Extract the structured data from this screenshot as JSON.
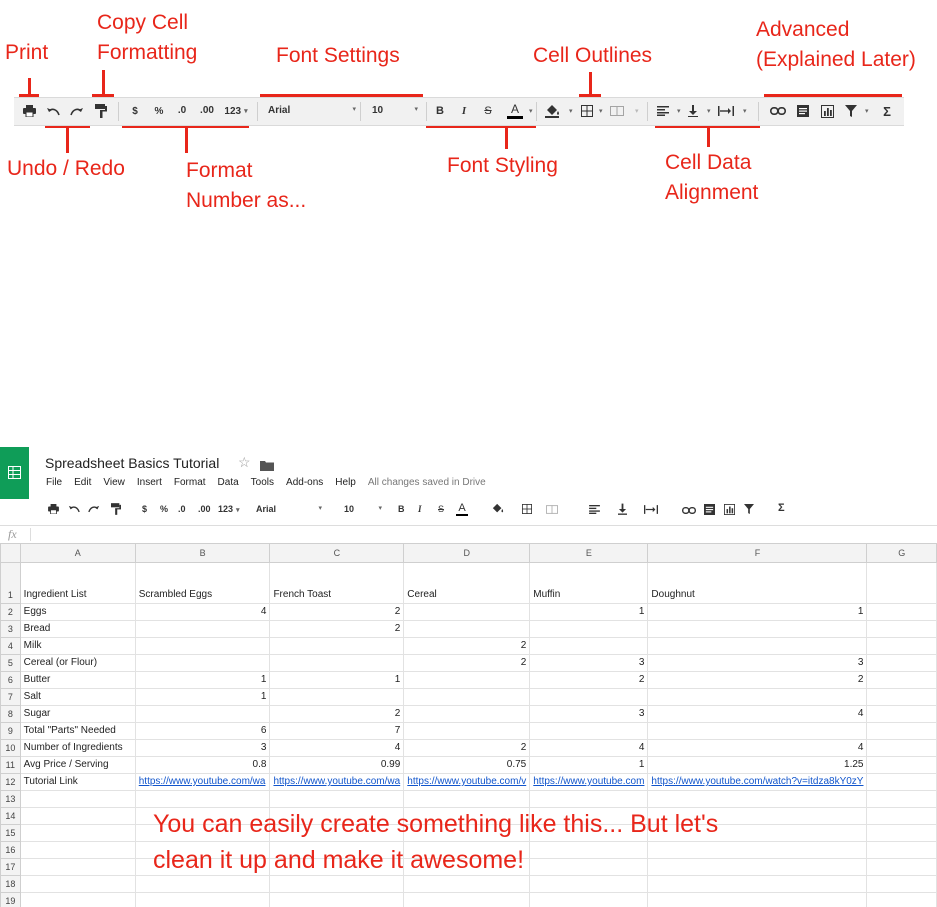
{
  "annotations": {
    "print": "Print",
    "copy_cell_1": "Copy Cell",
    "copy_cell_2": "Formatting",
    "font_settings": "Font Settings",
    "cell_outlines": "Cell Outlines",
    "advanced_1": "Advanced",
    "advanced_2": "(Explained Later)",
    "undo_redo": "Undo / Redo",
    "format_number_1": "Format",
    "format_number_2": "Number as...",
    "font_styling": "Font Styling",
    "cell_data_1": "Cell Data",
    "cell_data_2": "Alignment",
    "bottom_1": "You can easily create something like this... But let's",
    "bottom_2": "clean it up and make it awesome!"
  },
  "toolbar": {
    "dollar": "$",
    "percent": "%",
    "dec_less": ".0",
    "dec_more": ".00",
    "more_formats": "123",
    "font": "Arial",
    "size": "10",
    "bold": "B",
    "italic": "I",
    "strike": "S",
    "text_color": "A",
    "sigma": "Σ"
  },
  "app": {
    "title": "Spreadsheet Basics Tutorial",
    "menu": [
      "File",
      "Edit",
      "View",
      "Insert",
      "Format",
      "Data",
      "Tools",
      "Add-ons",
      "Help"
    ],
    "save_status": "All changes saved in Drive",
    "fx": "fx",
    "accent": "#0f9d58"
  },
  "sheet": {
    "columns": [
      "A",
      "B",
      "C",
      "D",
      "E",
      "F",
      "G"
    ],
    "rows": [
      [
        "Ingredient List",
        "Scrambled Eggs",
        "French Toast",
        "Cereal",
        "Muffin",
        "Doughnut",
        ""
      ],
      [
        "Eggs",
        "4",
        "2",
        "",
        "1",
        "1",
        ""
      ],
      [
        "Bread",
        "",
        "2",
        "",
        "",
        "",
        ""
      ],
      [
        "Milk",
        "",
        "",
        "2",
        "",
        "",
        ""
      ],
      [
        "Cereal (or Flour)",
        "",
        "",
        "2",
        "3",
        "3",
        ""
      ],
      [
        "Butter",
        "1",
        "1",
        "",
        "2",
        "2",
        ""
      ],
      [
        "Salt",
        "1",
        "",
        "",
        "",
        "",
        ""
      ],
      [
        "Sugar",
        "",
        "2",
        "",
        "3",
        "4",
        ""
      ],
      [
        "Total \"Parts\" Needed",
        "6",
        "7",
        "",
        "",
        "",
        ""
      ],
      [
        "Number of Ingredients",
        "3",
        "4",
        "2",
        "4",
        "4",
        ""
      ],
      [
        "Avg Price / Serving",
        "0.8",
        "0.99",
        "0.75",
        "1",
        "1.25",
        ""
      ],
      [
        "Tutorial Link",
        "https://www.youtube.com/wa",
        "https://www.youtube.com/wa",
        "https://www.youtube.com/v",
        "https://www.youtube.com",
        "https://www.youtube.com/watch?v=itdza8kY0zY",
        ""
      ],
      [
        "",
        "",
        "",
        "",
        "",
        "",
        ""
      ],
      [
        "",
        "",
        "",
        "",
        "",
        "",
        ""
      ],
      [
        "",
        "",
        "",
        "",
        "",
        "",
        ""
      ],
      [
        "",
        "",
        "",
        "",
        "",
        "",
        ""
      ],
      [
        "",
        "",
        "",
        "",
        "",
        "",
        ""
      ],
      [
        "",
        "",
        "",
        "",
        "",
        "",
        ""
      ],
      [
        "",
        "",
        "",
        "",
        "",
        "",
        ""
      ]
    ],
    "row_numbers": [
      "1",
      "2",
      "3",
      "4",
      "5",
      "6",
      "7",
      "8",
      "9",
      "10",
      "11",
      "12",
      "13",
      "14",
      "15",
      "16",
      "17",
      "18",
      "19"
    ]
  }
}
